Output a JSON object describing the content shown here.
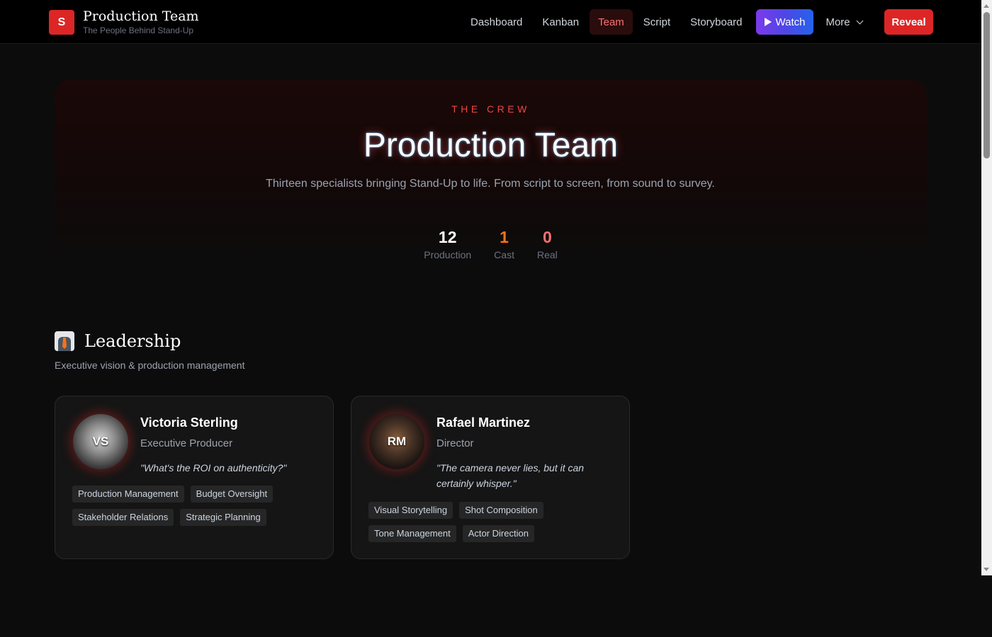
{
  "brand": {
    "logo_letter": "S",
    "title": "Production Team",
    "subtitle": "The People Behind Stand-Up"
  },
  "nav": {
    "items": [
      "Dashboard",
      "Kanban",
      "Team",
      "Script",
      "Storyboard"
    ],
    "active": "Team",
    "watch_label": "Watch",
    "more_label": "More",
    "reveal_label": "Reveal"
  },
  "hero": {
    "eyebrow": "THE CREW",
    "title": "Production Team",
    "description": "Thirteen specialists bringing Stand-Up to life. From script to screen, from sound to survey.",
    "stats": [
      {
        "value": "12",
        "label": "Production",
        "color": "#ffffff"
      },
      {
        "value": "1",
        "label": "Cast",
        "color": "#f97316"
      },
      {
        "value": "0",
        "label": "Real",
        "color": "#f87171"
      }
    ]
  },
  "section": {
    "icon": "necktie-icon",
    "title": "Leadership",
    "subtitle": "Executive vision & production management"
  },
  "members": [
    {
      "initials": "VS",
      "name": "Victoria Sterling",
      "role": "Executive Producer",
      "quote": "\"What's the ROI on authenticity?\"",
      "tags": [
        "Production Management",
        "Budget Oversight",
        "Stakeholder Relations",
        "Strategic Planning"
      ]
    },
    {
      "initials": "RM",
      "name": "Rafael Martinez",
      "role": "Director",
      "quote": "\"The camera never lies, but it can certainly whisper.\"",
      "tags": [
        "Visual Storytelling",
        "Shot Composition",
        "Tone Management",
        "Actor Direction"
      ]
    }
  ],
  "colors": {
    "accent": "#dc2626",
    "background": "#0c0c0c"
  }
}
